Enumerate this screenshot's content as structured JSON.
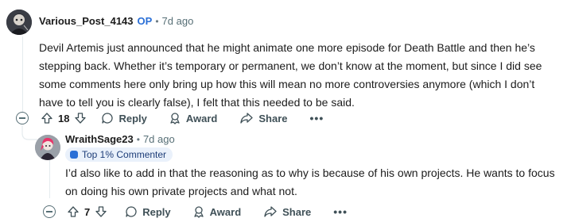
{
  "comments": [
    {
      "username": "Various_Post_4143",
      "op_label": "OP",
      "separator": "•",
      "time": "7d ago",
      "body": "Devil Artemis just announced that he might animate one more episode for Death Battle and then he’s stepping back. Whether it’s temporary or permanent, we don’t know at the moment, but since I did see some comments here only bring up how this will mean no more controversies anymore (which I don’t have to tell you is clearly false), I felt that this needed to be said.",
      "votes": "18",
      "reply_label": "Reply",
      "award_label": "Award",
      "share_label": "Share",
      "more_label": "•••"
    },
    {
      "username": "WraithSage23",
      "separator": "•",
      "time": "7d ago",
      "badge": "Top 1% Commenter",
      "body": "I’d also like to add in that the reasoning as to why is because of his own projects. He wants to focus on doing his own private projects and what not.",
      "votes": "7",
      "reply_label": "Reply",
      "award_label": "Award",
      "share_label": "Share",
      "more_label": "•••"
    }
  ],
  "icons": {
    "upvote": "upvote-icon",
    "downvote": "downvote-icon",
    "reply": "comment-icon",
    "award": "award-icon",
    "share": "share-icon",
    "collapse": "collapse-icon"
  },
  "colors": {
    "op_blue": "#2a6fd6",
    "badge_bg": "#eaf1fb",
    "meta_gray": "#576f76"
  }
}
